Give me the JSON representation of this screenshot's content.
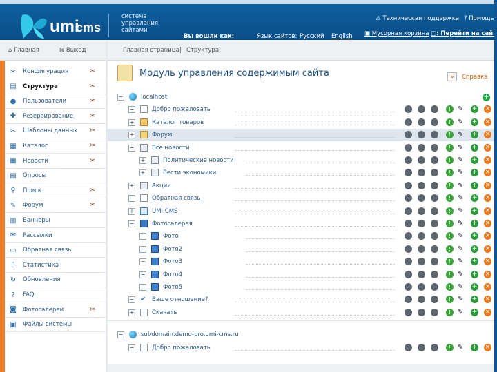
{
  "header": {
    "system_name": "система управления сайтами",
    "login_label": "Вы вошли как:",
    "login_user": "",
    "lang_label": "Язык сайтов:",
    "lang_ru": "Русский",
    "lang_en": "English",
    "support": "Техническая поддержка",
    "help": "Помощь",
    "trash": "Мусорная корзина",
    "site_view": "Перейти на сайт"
  },
  "nav": {
    "home": "Главная",
    "logout": "Выход",
    "breadcrumb_home": "Главная страница",
    "breadcrumb_sep": "|",
    "breadcrumb_current": "Структура"
  },
  "sidebar": {
    "items": [
      {
        "label": "Конфигурация",
        "icon": "config-icon",
        "settings": true
      },
      {
        "label": "Структура",
        "icon": "structure-icon",
        "settings": true,
        "current": true
      },
      {
        "label": "Пользователи",
        "icon": "users-icon",
        "settings": true
      },
      {
        "label": "Резервирование",
        "icon": "backup-icon",
        "settings": true
      },
      {
        "label": "Шаблоны данных",
        "icon": "templates-icon",
        "settings": true
      },
      {
        "label": "Каталог",
        "icon": "catalog-icon",
        "settings": true
      },
      {
        "label": "Новости",
        "icon": "news-icon",
        "settings": true
      },
      {
        "label": "Опросы",
        "icon": "polls-icon",
        "settings": false
      },
      {
        "label": "Поиск",
        "icon": "search-icon",
        "settings": true
      },
      {
        "label": "Форум",
        "icon": "forum-icon",
        "settings": true
      },
      {
        "label": "Баннеры",
        "icon": "banners-icon",
        "settings": false
      },
      {
        "label": "Рассылки",
        "icon": "mailing-icon",
        "settings": false
      },
      {
        "label": "Обратная связь",
        "icon": "feedback-icon",
        "settings": false
      },
      {
        "label": "Статистика",
        "icon": "stats-icon",
        "settings": false
      },
      {
        "label": "Обновления",
        "icon": "updates-icon",
        "settings": false
      },
      {
        "label": "FAQ",
        "icon": "faq-icon",
        "settings": false
      },
      {
        "label": "Фотогалереи",
        "icon": "photos-icon",
        "settings": true
      },
      {
        "label": "Файлы системы",
        "icon": "files-icon",
        "settings": false
      }
    ]
  },
  "main": {
    "title": "Модуль управления содержимым сайта",
    "help_label": "Справка",
    "trees": [
      {
        "domain": "localhost",
        "rows": [
          {
            "label": "Добро пожаловать",
            "level": 1,
            "toggle": "-",
            "icon": "page-icon"
          },
          {
            "label": "Каталог товаров",
            "level": 1,
            "toggle": "+",
            "icon": "catalog-item-icon"
          },
          {
            "label": "Форум",
            "level": 1,
            "toggle": "+",
            "icon": "forum-item-icon",
            "highlight": true
          },
          {
            "label": "Все новости",
            "level": 1,
            "toggle": "-",
            "icon": "news-list-icon"
          },
          {
            "label": "Политические новости",
            "level": 2,
            "toggle": "+",
            "icon": "news-list-icon"
          },
          {
            "label": "Вести экономики",
            "level": 2,
            "toggle": "+",
            "icon": "news-list-icon"
          },
          {
            "label": "Акции",
            "level": 1,
            "toggle": "+",
            "icon": "news-list-icon"
          },
          {
            "label": "Обратная связь",
            "level": 1,
            "toggle": "-",
            "icon": "page-icon"
          },
          {
            "label": "UMI.CMS",
            "level": 1,
            "toggle": "+",
            "icon": "doc-icon"
          },
          {
            "label": "Фотогалерея",
            "level": 1,
            "toggle": "-",
            "icon": "gallery-icon"
          },
          {
            "label": "Фото",
            "level": 2,
            "toggle": "-",
            "icon": "photo-icon"
          },
          {
            "label": "Фото2",
            "level": 2,
            "toggle": "-",
            "icon": "photo-icon"
          },
          {
            "label": "Фото3",
            "level": 2,
            "toggle": "-",
            "icon": "photo-icon"
          },
          {
            "label": "Фото4",
            "level": 2,
            "toggle": "-",
            "icon": "photo-icon"
          },
          {
            "label": "Фото5",
            "level": 2,
            "toggle": "-",
            "icon": "photo-icon"
          },
          {
            "label": "Ваше отношение?",
            "level": 1,
            "toggle": "-",
            "icon": "vote-icon"
          },
          {
            "label": "Скачать",
            "level": 1,
            "toggle": "+",
            "icon": "page-icon"
          }
        ]
      },
      {
        "domain": "subdomain.demo-pro.umi-cms.ru",
        "rows": [
          {
            "label": "Добро пожаловать",
            "level": 1,
            "toggle": "-",
            "icon": "page-icon"
          }
        ]
      }
    ]
  },
  "colors": {
    "header_bg": "#0e5f9f",
    "accent_orange": "#f07e28",
    "link_blue": "#2c5a88",
    "title_blue": "#1a4f85",
    "action_green": "#3ba43a",
    "action_orange": "#ea7a1e"
  }
}
